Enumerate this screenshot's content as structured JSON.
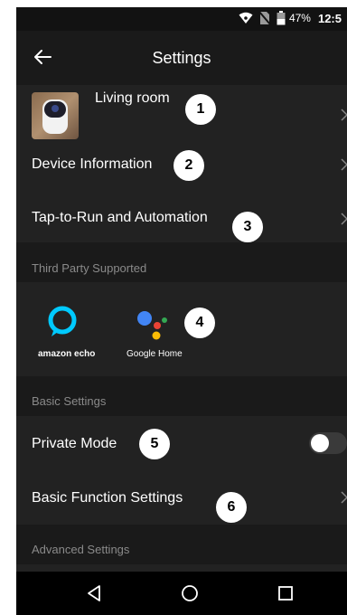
{
  "status_bar": {
    "battery": "47%",
    "time": "12:5"
  },
  "header": {
    "title": "Settings"
  },
  "device": {
    "name": "Living room",
    "badge": "1"
  },
  "rows": {
    "device_info": {
      "label": "Device Information",
      "badge": "2"
    },
    "tap_to_run": {
      "label": "Tap-to-Run and Automation",
      "badge": "3"
    }
  },
  "third_party": {
    "header": "Third Party Supported",
    "badge": "4",
    "partners": [
      {
        "name": "amazon echo",
        "icon": "alexa-icon"
      },
      {
        "name": "Google Home",
        "icon": "google-assistant-icon"
      }
    ]
  },
  "basic_settings": {
    "header": "Basic Settings",
    "private_mode": {
      "label": "Private Mode",
      "badge": "5",
      "enabled": false
    },
    "basic_function": {
      "label": "Basic Function Settings",
      "badge": "6"
    }
  },
  "advanced_settings": {
    "header": "Advanced Settings"
  },
  "colors": {
    "background": "#1a1a1a",
    "row": "#222222",
    "section_text": "#8a8a8a",
    "alexa": "#00caff"
  }
}
